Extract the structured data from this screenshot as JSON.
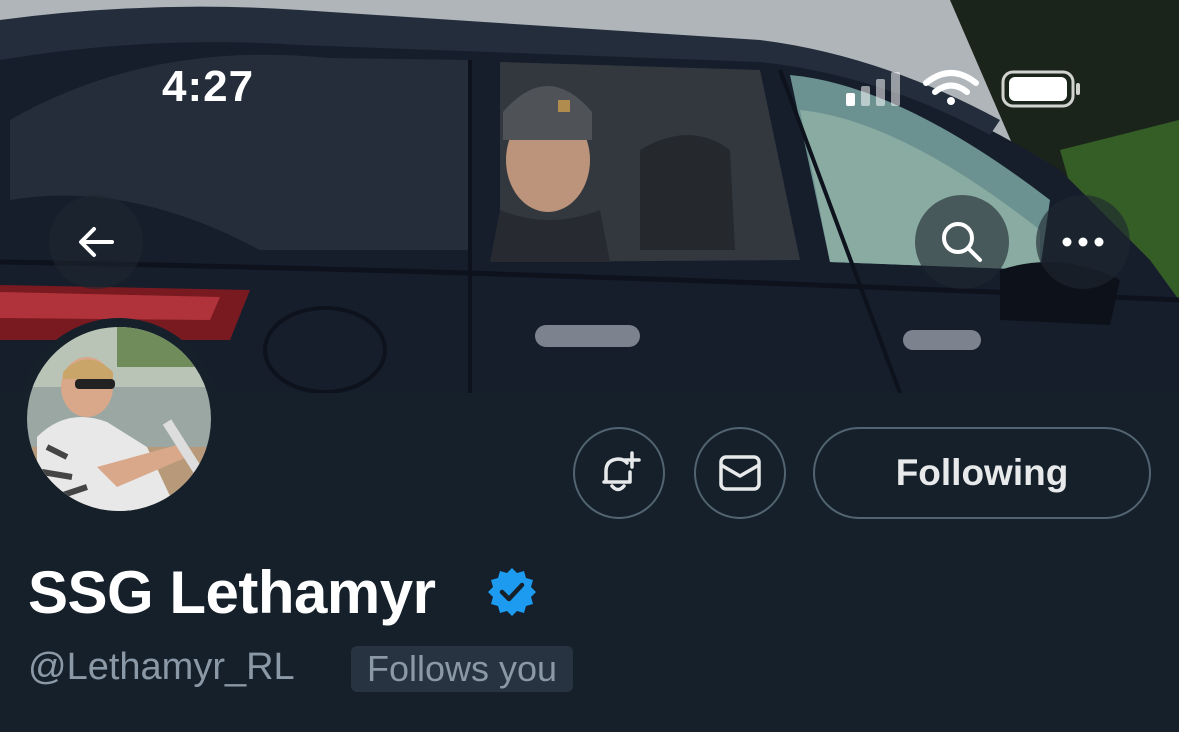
{
  "status_bar": {
    "time": "4:27",
    "icons": [
      "cellular-signal-icon",
      "wifi-icon",
      "battery-icon"
    ]
  },
  "header": {
    "back_icon": "arrow-left-icon",
    "search_icon": "search-icon",
    "more_icon": "more-horizontal-icon"
  },
  "banner": {
    "description_icon": "banner-photo"
  },
  "profile": {
    "display_name": "SSG Lethamyr",
    "handle": "@Lethamyr_RL",
    "follows_you": "Follows you",
    "verified_icon": "verified-badge-icon",
    "verified_color": "#1d9bf0"
  },
  "actions": {
    "notify_icon": "bell-plus-icon",
    "message_icon": "envelope-icon",
    "following_label": "Following"
  },
  "colors": {
    "background": "#15202b",
    "border": "#536471",
    "secondary_text": "#8b98a5",
    "badge_bg": "#273340"
  }
}
